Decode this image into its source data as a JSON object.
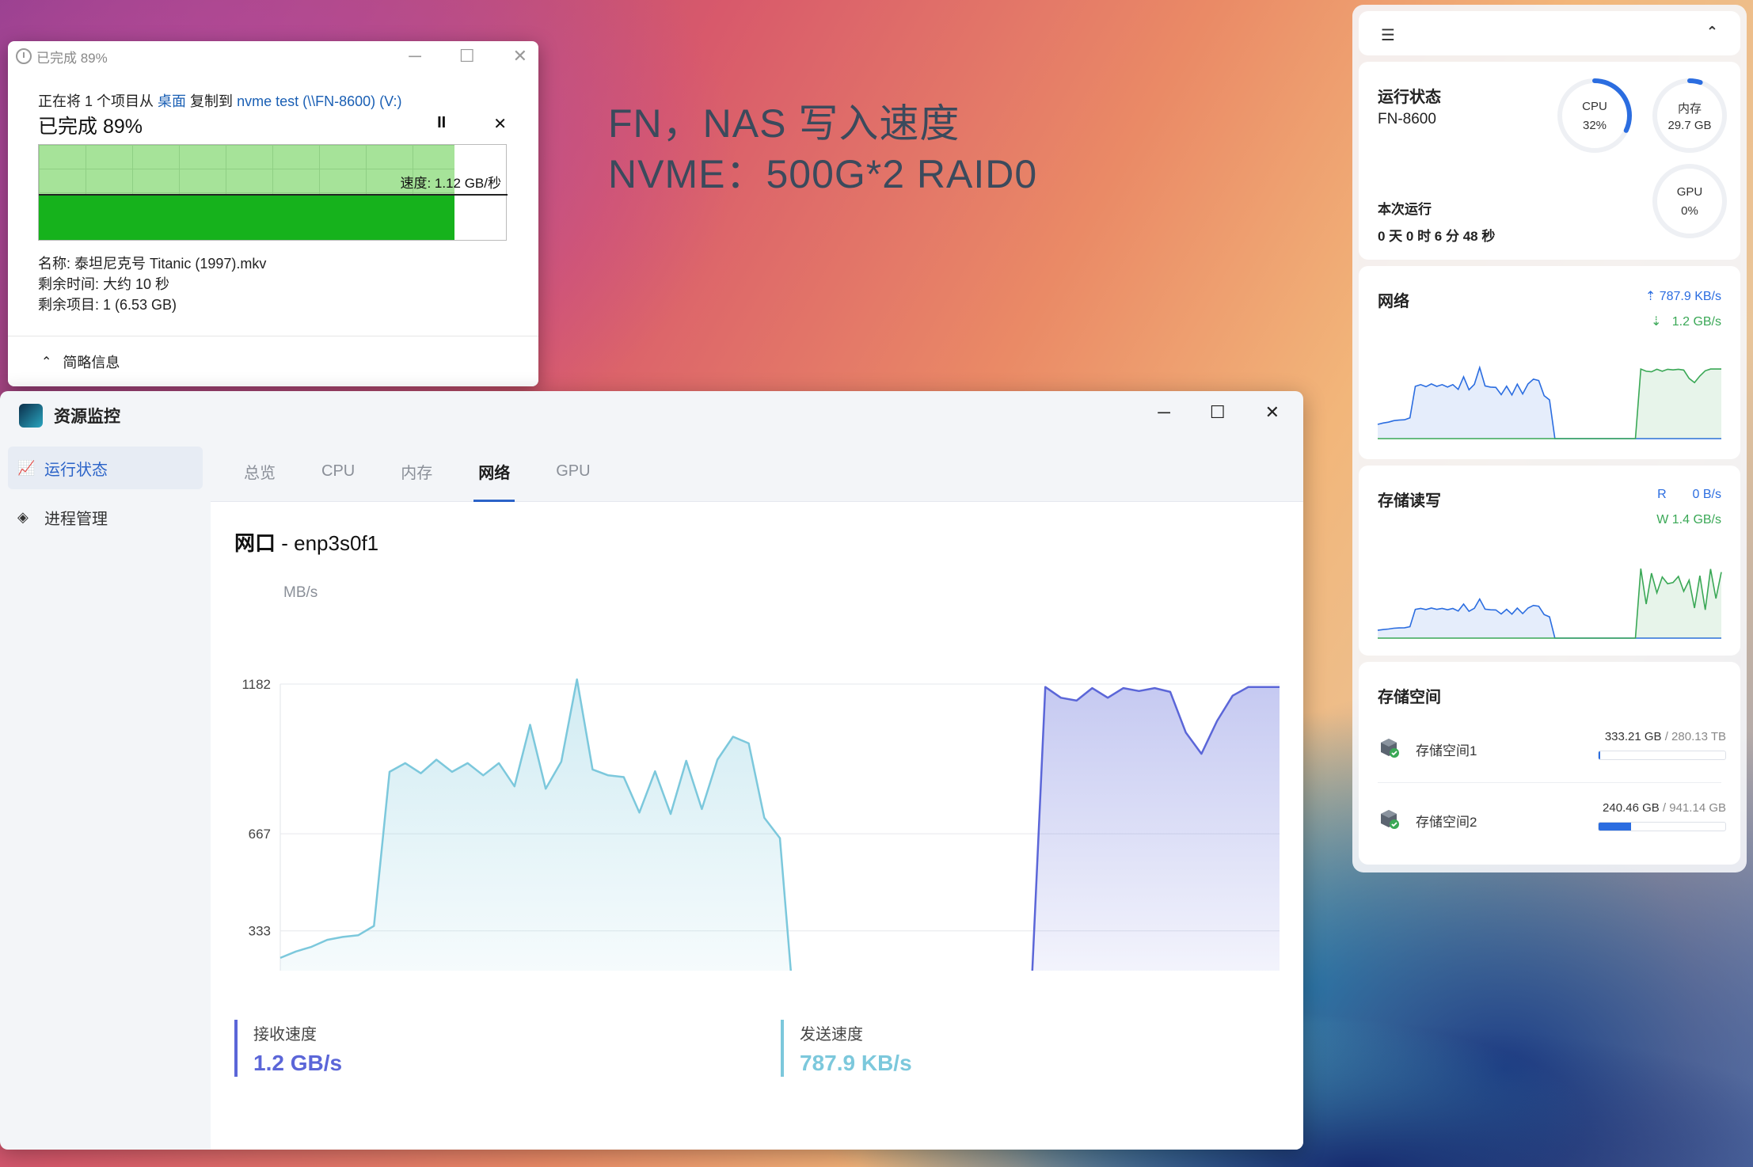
{
  "overlay": {
    "line1": "FN，NAS 写入速度",
    "line2": "NVME：500G*2 RAID0"
  },
  "copy_dialog": {
    "title": "已完成 89%",
    "prefix": "正在将 1 个项目从",
    "source": "桌面",
    "middle": "复制到",
    "dest": "nvme test (\\\\FN-8600) (V:)",
    "percent": "已完成 89%",
    "progress": 0.89,
    "pause_symbol": "II",
    "close_symbol": "✕",
    "speed": "速度: 1.12 GB/秒",
    "name_line": "名称: 泰坦尼克号 Titanic (1997).mkv",
    "time_line": "剩余时间: 大约 10 秒",
    "items_line": "剩余项目: 1 (6.53 GB)",
    "footer": "简略信息"
  },
  "resource_monitor": {
    "title": "资源监控",
    "sidebar": [
      {
        "label": "运行状态",
        "icon": "chart-line-icon"
      },
      {
        "label": "进程管理",
        "icon": "layers-icon"
      }
    ],
    "tabs": [
      "总览",
      "CPU",
      "内存",
      "网络",
      "GPU"
    ],
    "active_tab": "网络",
    "interface_label": "网口",
    "interface_name": "enp3s0f1",
    "unit": "MB/s",
    "receive_label": "接收速度",
    "receive_value": "1.2 GB/s",
    "send_label": "发送速度",
    "send_value": "787.9 KB/s",
    "receive_color": "#5b66d8",
    "send_color": "#7cc8dc"
  },
  "chart_data": {
    "type": "area",
    "ylabel": "MB/s",
    "yticks": [
      333,
      667,
      1182
    ],
    "ylim": [
      0,
      1182
    ],
    "series": [
      {
        "name": "发送速度",
        "color": "#7cc8dc",
        "values": [
          240,
          262,
          278,
          302,
          312,
          318,
          350,
          880,
          910,
          875,
          922,
          880,
          910,
          868,
          910,
          830,
          1042,
          822,
          915,
          1198,
          888,
          868,
          862,
          740,
          882,
          735,
          918,
          752,
          922,
          1001,
          978,
          722,
          652,
          0,
          0,
          0,
          0,
          0,
          0,
          0,
          0,
          0,
          0,
          0,
          0,
          0,
          0,
          0,
          0,
          0,
          0,
          0,
          0,
          0,
          0,
          0,
          0,
          0,
          0,
          0,
          0,
          0,
          0,
          0,
          0
        ]
      },
      {
        "name": "接收速度",
        "color": "#5b66d8",
        "values": [
          0,
          0,
          0,
          0,
          0,
          0,
          0,
          0,
          0,
          0,
          0,
          0,
          0,
          0,
          0,
          0,
          0,
          0,
          0,
          0,
          0,
          0,
          0,
          0,
          0,
          0,
          0,
          0,
          0,
          0,
          0,
          0,
          0,
          0,
          0,
          0,
          0,
          0,
          0,
          0,
          0,
          0,
          0,
          0,
          0,
          0,
          0,
          0,
          0,
          1172,
          1135,
          1125,
          1168,
          1135,
          1168,
          1158,
          1168,
          1155,
          1015,
          942,
          1055,
          1142,
          1172,
          1172,
          1172
        ]
      }
    ]
  },
  "widget": {
    "status_title": "运行状态",
    "hostname": "FN-8600",
    "cpu_label": "CPU",
    "cpu_value": "32%",
    "cpu_pct": 32,
    "mem_label": "内存",
    "mem_value": "29.7 GB",
    "mem_pct": 5,
    "gpu_label": "GPU",
    "gpu_value": "0%",
    "uptime_label": "本次运行",
    "uptime_value": "0 天 0 时 6 分 48 秒",
    "net_title": "网络",
    "net_up": "787.9 KB/s",
    "net_down": "1.2 GB/s",
    "disk_title": "存储读写",
    "disk_r_label": "R",
    "disk_r": "0 B/s",
    "disk_w": "W 1.4 GB/s",
    "storage_title": "存储空间",
    "storage": [
      {
        "name": "存储空间1",
        "used": "333.21 GB",
        "total": "280.13 TB",
        "fraction": 0.01
      },
      {
        "name": "存储空间2",
        "used": "240.46 GB",
        "total": "941.14 GB",
        "fraction": 0.255
      }
    ]
  }
}
